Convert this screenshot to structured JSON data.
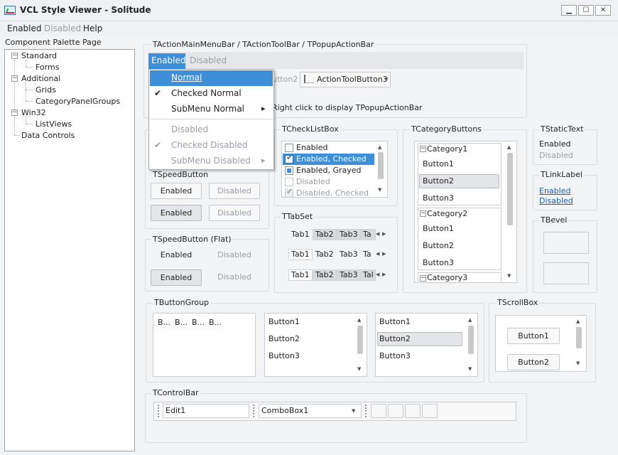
{
  "window": {
    "title": "VCL Style Viewer - Solitude",
    "minimize": "▁",
    "maximize": "☐",
    "close": "✕"
  },
  "menu": {
    "items": [
      "Enabled",
      "Disabled",
      "Help"
    ]
  },
  "left_panel": {
    "title": "Component Palette Page",
    "tree": [
      {
        "label": "Standard",
        "level": 0,
        "expander": "−"
      },
      {
        "label": "Forms",
        "level": 1
      },
      {
        "label": "Additional",
        "level": 0,
        "expander": "−"
      },
      {
        "label": "Grids",
        "level": 1
      },
      {
        "label": "CategoryPanelGroups",
        "level": 1
      },
      {
        "label": "Win32",
        "level": 0,
        "expander": "−"
      },
      {
        "label": "ListViews",
        "level": 1
      },
      {
        "label": "Data Controls",
        "level": 0
      }
    ]
  },
  "action_bar": {
    "group_label": "TActionMainMenuBar / TActionToolBar / TPopupActionBar",
    "menu_enabled": "Enabled",
    "menu_disabled": "Disabled",
    "toolbutton2_partial": "utton2",
    "toolbutton3": "ActionToolButton3",
    "popup_hint": "Right click to display TPopupActionBar"
  },
  "dropdown": {
    "items": [
      {
        "label": "Normal",
        "state": "highlighted",
        "check": "",
        "submenu": ""
      },
      {
        "label": "Checked Normal",
        "state": "normal",
        "check": "✔",
        "submenu": ""
      },
      {
        "label": "SubMenu Normal",
        "state": "normal",
        "check": "",
        "submenu": "▸"
      },
      {
        "label": "Disabled",
        "state": "disabled",
        "check": "",
        "submenu": ""
      },
      {
        "label": "Checked Disabled",
        "state": "disabled",
        "check": "✔",
        "submenu": ""
      },
      {
        "label": "SubMenu Disabled",
        "state": "disabled",
        "check": "",
        "submenu": "▸"
      }
    ]
  },
  "speed_button": {
    "label": "TSpeedButton",
    "rows": [
      [
        "Enabled",
        "Disabled"
      ],
      [
        "Enabled",
        "Disabled"
      ]
    ]
  },
  "speed_button_flat": {
    "label": "TSpeedButton (Flat)",
    "rows": [
      [
        "Enabled",
        "Disabled"
      ],
      [
        "Enabled",
        "Disabled"
      ]
    ]
  },
  "checklist": {
    "label": "TCheckListBox",
    "items": [
      {
        "label": "Enabled",
        "state": "unchecked"
      },
      {
        "label": "Enabled, Checked",
        "state": "checked",
        "selected": true
      },
      {
        "label": "Enabled, Grayed",
        "state": "grayed"
      },
      {
        "label": "Disabled",
        "state": "disabled"
      },
      {
        "label": "Disabled, Checked",
        "state": "disabled-checked"
      }
    ]
  },
  "tabset": {
    "label": "TTabSet",
    "rows": [
      [
        "Tab1",
        "Tab2",
        "Tab3",
        "Ta"
      ],
      [
        "Tab1",
        "Tab2",
        "Tab3",
        "Ta"
      ],
      [
        "Tab1",
        "Tab2",
        "Tab3",
        "Tal"
      ]
    ]
  },
  "category_buttons": {
    "label": "TCategoryButtons",
    "categories": [
      {
        "name": "Category1",
        "buttons": [
          "Button1",
          "Button2",
          "Button3"
        ]
      },
      {
        "name": "Category2",
        "buttons": [
          "Button1",
          "Button2",
          "Button3"
        ]
      },
      {
        "name": "Category3",
        "buttons": []
      }
    ]
  },
  "static_text": {
    "label": "TStaticText",
    "enabled": "Enabled",
    "disabled": "Disabled"
  },
  "link_label": {
    "label": "TLinkLabel",
    "enabled": "Enabled",
    "disabled": "Disabled"
  },
  "bevel": {
    "label": "TBevel"
  },
  "button_group": {
    "label": "TButtonGroup",
    "compact": [
      "B...",
      "B...",
      "B...",
      "B..."
    ],
    "list1": [
      "Button1",
      "Button2",
      "Button3"
    ],
    "list2": [
      "Button1",
      "Button2",
      "Button3"
    ]
  },
  "scroll_box": {
    "label": "TScrollBox",
    "buttons": [
      "Button1",
      "Button2"
    ]
  },
  "control_bar": {
    "label": "TControlBar",
    "edit": "Edit1",
    "combo": "ComboBox1"
  },
  "colors": {
    "selection": "#3c8fd8",
    "link": "#1a5fb4"
  }
}
